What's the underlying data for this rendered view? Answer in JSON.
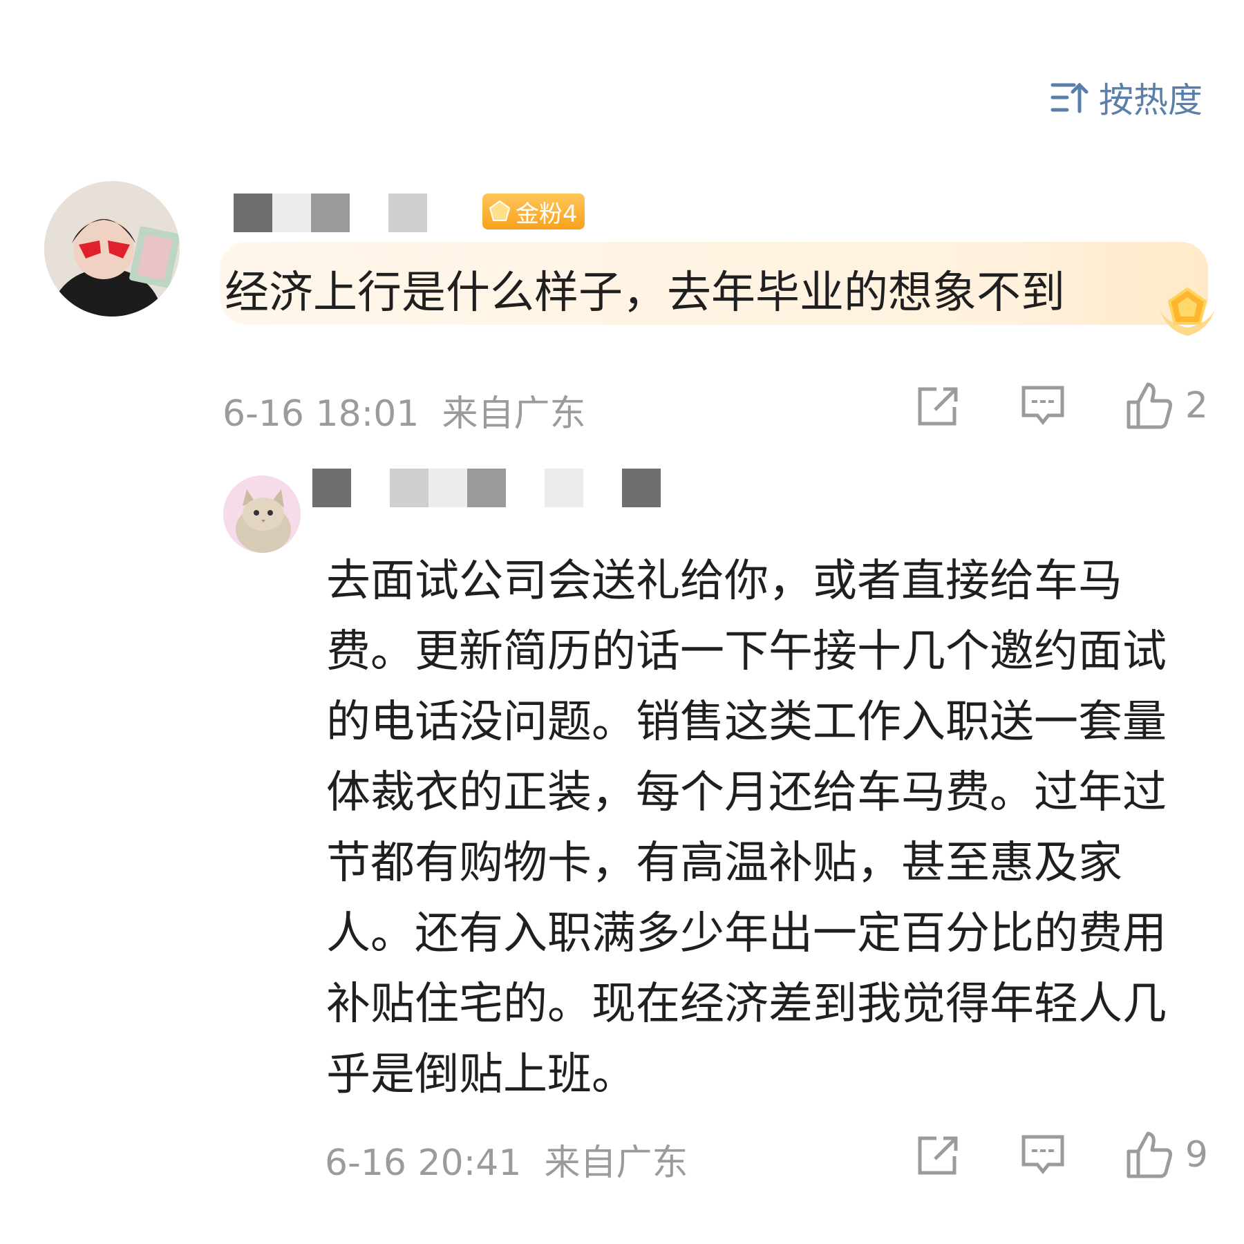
{
  "sort": {
    "label": "按热度",
    "color": "#5a7fa8"
  },
  "comment": {
    "badge": "金粉4",
    "text": "经济上行是什么样子，去年毕业的想象不到",
    "time": "6-16 18:01",
    "location": "来自广东",
    "likes": "2"
  },
  "reply": {
    "text": "去面试公司会送礼给你，或者直接给车马费。更新简历的话一下午接十几个邀约面试的电话没问题。销售这类工作入职送一套量体裁衣的正装，每个月还给车马费。过年过节都有购物卡，有高温补贴，甚至惠及家人。还有入职满多少年出一定百分比的费用补贴住宅的。现在经济差到我觉得年轻人几乎是倒贴上班。",
    "time": "6-16 20:41",
    "location": "来自广东",
    "likes": "9"
  },
  "icons": {
    "sort": "sort-icon",
    "share": "share-icon",
    "comment": "comment-icon",
    "like": "thumbs-up-icon",
    "badge": "gem-icon"
  }
}
